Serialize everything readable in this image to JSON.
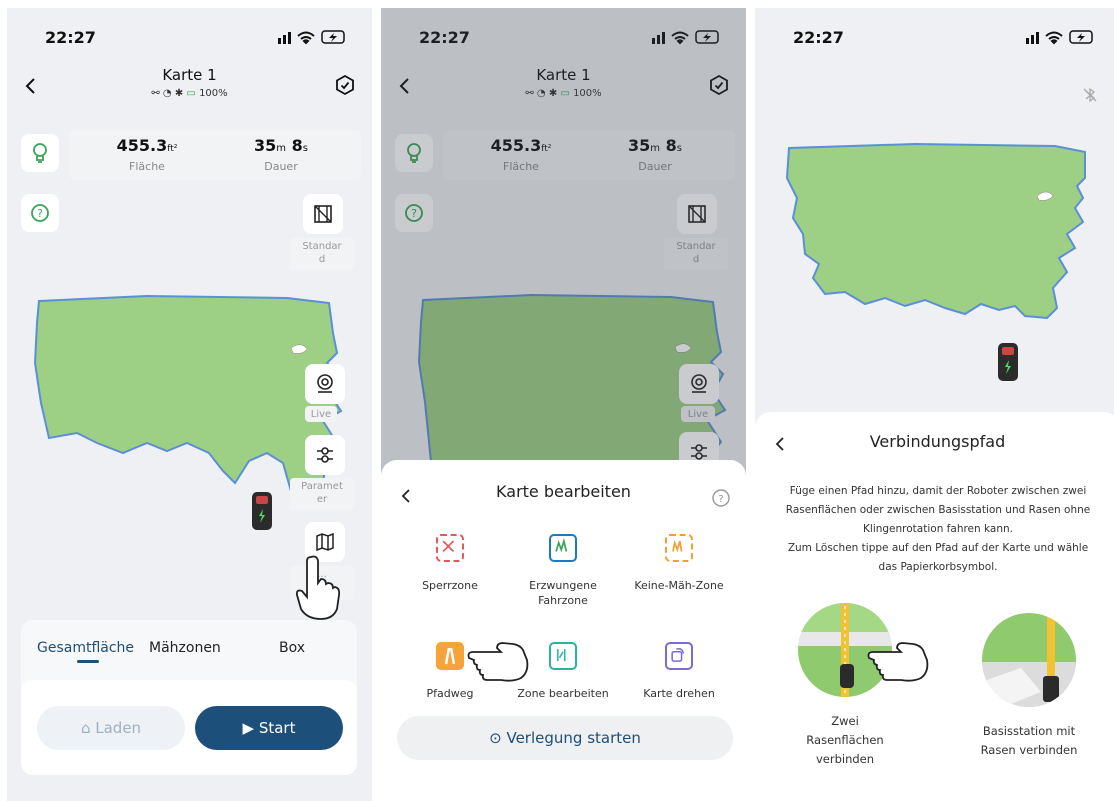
{
  "status": {
    "time": "22:27"
  },
  "screen1": {
    "title": "Karte 1",
    "battery": "100%",
    "area_value": "455.3",
    "area_unit": "ft²",
    "area_label": "Fläche",
    "dur_min": "35",
    "dur_min_unit": "m",
    "dur_sec": "8",
    "dur_sec_unit": "s",
    "duration_label": "Dauer",
    "mode_label_1": "Standar",
    "mode_label_2": "d",
    "live_label": "Live",
    "param_label_1": "Paramet",
    "param_label_2": "er",
    "map_label_1": "...",
    "tabs": [
      "Gesamtfläche",
      "Mähzonen",
      "Box"
    ],
    "load_label": "Laden",
    "start_label": "Start"
  },
  "screen2": {
    "title": "Karte 1",
    "battery": "100%",
    "area_value": "455.3",
    "area_unit": "ft²",
    "area_label": "Fläche",
    "dur_min": "35",
    "dur_min_unit": "m",
    "dur_sec": "8",
    "dur_sec_unit": "s",
    "duration_label": "Dauer",
    "mode_label_1": "Standar",
    "mode_label_2": "d",
    "live_label": "Live",
    "sheet_title": "Karte bearbeiten",
    "items": [
      {
        "label": "Sperrzone",
        "icon": "no-go-zone-icon"
      },
      {
        "label": "Erzwungene Fahrzone",
        "icon": "forced-zone-icon"
      },
      {
        "label": "Keine-Mäh-Zone",
        "icon": "no-mow-zone-icon"
      },
      {
        "label": "Pfadweg",
        "icon": "path-icon"
      },
      {
        "label": "Zone bearbeiten",
        "icon": "edit-zone-icon"
      },
      {
        "label": "Karte drehen",
        "icon": "rotate-map-icon"
      }
    ],
    "lay_button": "Verlegung starten"
  },
  "screen3": {
    "sheet_title": "Verbindungspfad",
    "desc_1": "Füge einen Pfad hinzu, damit der Roboter zwischen zwei",
    "desc_2": "Rasenflächen oder zwischen Basisstation und Rasen ohne",
    "desc_3": "Klingenrotation fahren kann.",
    "desc_4": "Zum Löschen tippe auf den Pfad auf der Karte und wähle",
    "desc_5": "das Papierkorbsymbol.",
    "option1_1": "Zwei",
    "option1_2": "Rasenflächen",
    "option1_3": "verbinden",
    "option2_1": "Basisstation mit",
    "option2_2": "Rasen verbinden"
  },
  "colors": {
    "accent": "#1c4f7a",
    "lawn": "#9dcf85",
    "lawn_border": "#5b8fd6",
    "green_icon": "#3aa45a"
  }
}
